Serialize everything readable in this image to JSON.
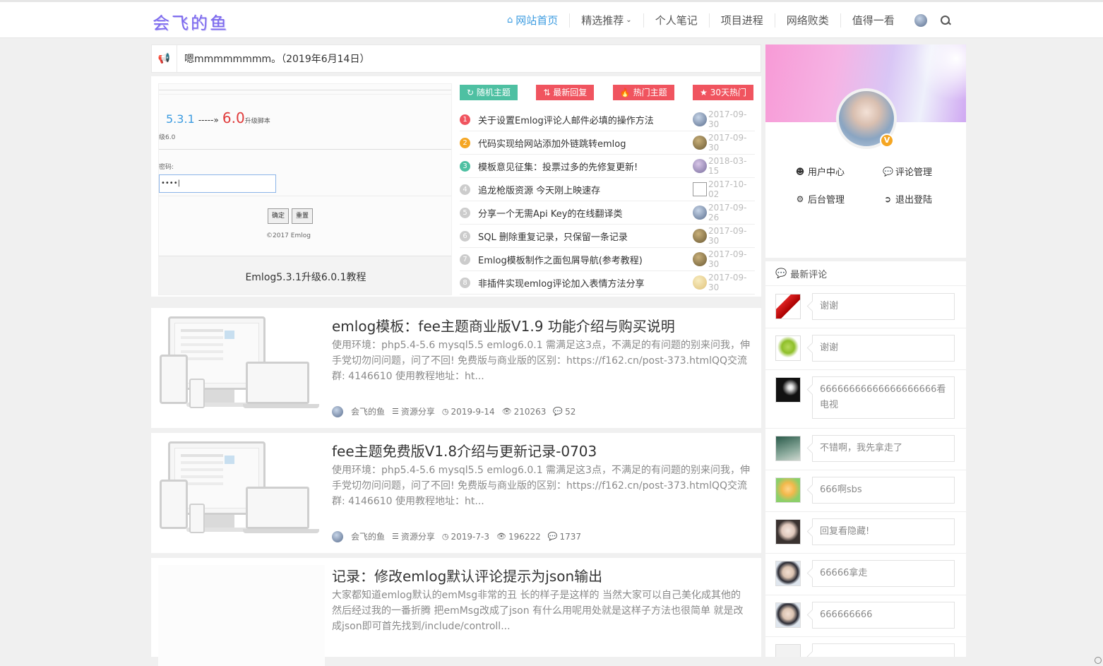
{
  "header": {
    "logo": "会飞的鱼",
    "nav": [
      {
        "label": "网站首页",
        "icon": "home-icon",
        "active": true
      },
      {
        "label": "精选推荐",
        "icon": "chevron-down-icon"
      },
      {
        "label": "个人笔记"
      },
      {
        "label": "项目进程"
      },
      {
        "label": "网络败类"
      },
      {
        "label": "值得一看"
      }
    ]
  },
  "notice": {
    "text": "嗯mmmmmmmm。（2019年6月14日）",
    "icon": "bullhorn-icon"
  },
  "slider": {
    "ver1": "5.3.1",
    "arrow": "-----»",
    "ver2": "6.0",
    "ver2_suffix": "升级脚本",
    "line1": "级6.0",
    "pwd_label": "密码:",
    "pwd_value": "••••|",
    "btn_ok": "确定",
    "btn_reset": "重置",
    "copyright": "©2017 Emlog",
    "caption": "Emlog5.3.1升级6.0.1教程"
  },
  "hot_tabs": [
    {
      "label": "随机主题",
      "color": "#4ec0a2"
    },
    {
      "label": "最新回复",
      "color": "#f0545f"
    },
    {
      "label": "热门主题",
      "color": "#f0545f"
    },
    {
      "label": "30天热门",
      "color": "#f0545f"
    }
  ],
  "hot_list": [
    {
      "num": "1",
      "title": "关于设置Emlog评论人邮件必填的操作方法",
      "date": "2017-09-30",
      "num_color": "#f0545f"
    },
    {
      "num": "2",
      "title": "代码实现给网站添加外链跳转emlog",
      "date": "2017-09-30",
      "num_color": "#f5a623"
    },
    {
      "num": "3",
      "title": "模板意见征集：投票过多的先修复更新!",
      "date": "2018-03-15",
      "num_color": "#4ec0a2"
    },
    {
      "num": "4",
      "title": "追龙枪版资源 今天刚上映速存",
      "date": "2017-10-02",
      "num_color": "#cccccc"
    },
    {
      "num": "5",
      "title": "分享一个无需Api Key的在线翻译类",
      "date": "2017-09-26",
      "num_color": "#cccccc"
    },
    {
      "num": "6",
      "title": "SQL 删除重复记录，只保留一条记录",
      "date": "2017-09-30",
      "num_color": "#cccccc"
    },
    {
      "num": "7",
      "title": "Emlog模板制作之面包屑导航(参考教程)",
      "date": "2017-09-30",
      "num_color": "#cccccc"
    },
    {
      "num": "8",
      "title": "非插件实现emlog评论加入表情方法分享",
      "date": "2017-09-30",
      "num_color": "#cccccc"
    }
  ],
  "posts": [
    {
      "title": "emlog模板：fee主题商业版V1.9 功能介绍与购买说明",
      "excerpt": "使用环境：php5.4-5.6 mysql5.5 emlog6.0.1 需满足这3点，不满足的有问题的别来问我，伸手党切勿问问题，问了不回! 免费版与商业版的区别：https://f162.cn/post-373.htmlQQ交流群: 4146610 使用教程地址：ht...",
      "author": "会飞的鱼",
      "category": "资源分享",
      "date": "2019-9-14",
      "views": "210263",
      "comments": "52"
    },
    {
      "title": "fee主题免费版V1.8介绍与更新记录-0703",
      "excerpt": "使用环境：php5.4-5.6 mysql5.5 emlog6.0.1 需满足这3点，不满足的有问题的别来问我，伸手党切勿问问题，问了不回! 免费版与商业版的区别：https://f162.cn/post-373.htmlQQ交流群: 4146610 使用教程地址：ht...",
      "author": "会飞的鱼",
      "category": "资源分享",
      "date": "2019-7-3",
      "views": "196222",
      "comments": "1737"
    },
    {
      "title": "记录：修改emlog默认评论提示为json输出",
      "excerpt": "大家都知道emlog默认的emMsg非常的丑 长的样子是这样的 当然大家可以自己美化成其他的 然后经过我的一番折腾 把emMsg改成了json 有什么用呢用处就是这样子方法也很简单 就是改成json即可首先找到/include/controll..."
    }
  ],
  "user": {
    "links": [
      {
        "label": "用户中心",
        "icon": "user-circle-icon"
      },
      {
        "label": "评论管理",
        "icon": "comments-icon"
      },
      {
        "label": "后台管理",
        "icon": "cogs-icon"
      },
      {
        "label": "退出登陆",
        "icon": "sign-out-icon"
      }
    ],
    "badge": "V"
  },
  "comments": {
    "title": "最新评论",
    "items": [
      {
        "text": "谢谢"
      },
      {
        "text": "谢谢"
      },
      {
        "text": "66666666666666666666看电视"
      },
      {
        "text": "不错啊，我先拿走了"
      },
      {
        "text": "666啊sbs"
      },
      {
        "text": "回复看隐藏!"
      },
      {
        "text": "66666拿走"
      },
      {
        "text": "666666666"
      }
    ]
  }
}
